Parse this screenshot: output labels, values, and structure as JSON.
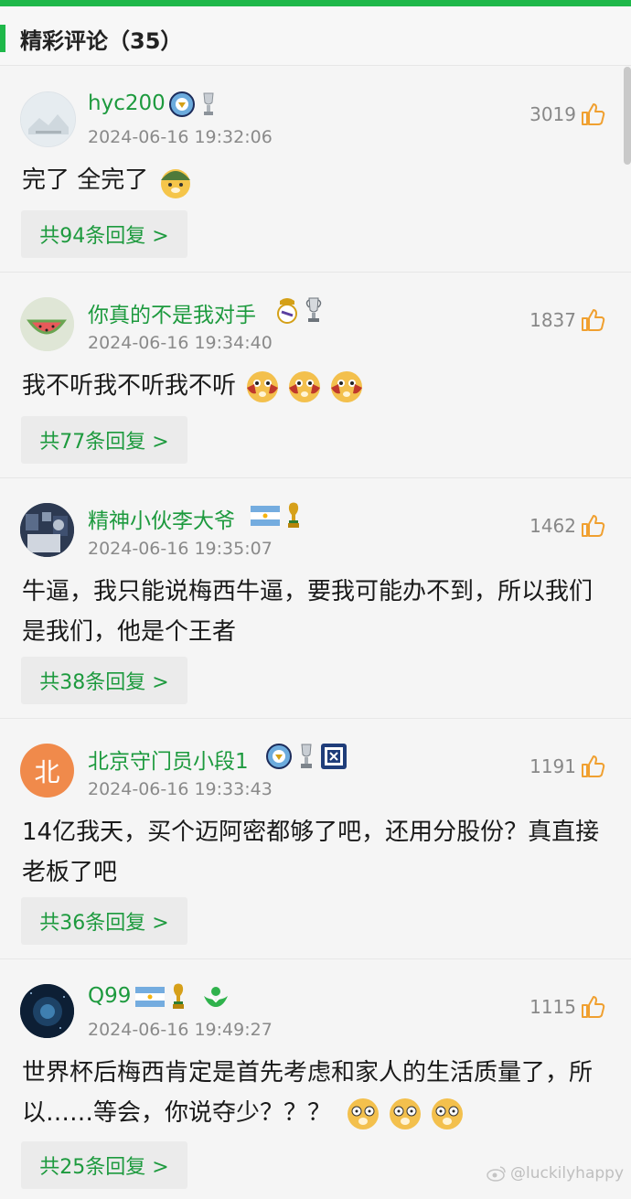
{
  "header": {
    "title": "精彩评论（35）"
  },
  "colors": {
    "brand": "#1fb84a",
    "username": "#1d9a3e",
    "thumb": "#f0a030"
  },
  "comments": [
    {
      "username": "hyc200",
      "time": "2024-06-16 19:32:06",
      "likes": "3019",
      "text": "完了 全完了",
      "emoji": [
        "helmet-doge-emoji"
      ],
      "replies": "共94条回复 >"
    },
    {
      "username": "你真的不是我对手",
      "time": "2024-06-16 19:34:40",
      "likes": "1837",
      "text": "我不听我不听我不听",
      "emoji": [
        "covering-ears-doge-emoji",
        "covering-ears-doge-emoji",
        "covering-ears-doge-emoji"
      ],
      "replies": "共77条回复 >"
    },
    {
      "username": "精神小伙李大爷",
      "time": "2024-06-16 19:35:07",
      "likes": "1462",
      "text": "牛逼，我只能说梅西牛逼，要我可能办不到，所以我们是我们，他是个王者",
      "replies": "共38条回复 >"
    },
    {
      "username": "北京守门员小段1",
      "avatar_text": "北",
      "time": "2024-06-16 19:33:43",
      "likes": "1191",
      "text": "14亿我天，买个迈阿密都够了吧，还用分股份？真直接老板了吧",
      "replies": "共36条回复 >"
    },
    {
      "username": "Q99",
      "time": "2024-06-16 19:49:27",
      "likes": "1115",
      "text": "世界杯后梅西肯定是首先考虑和家人的生活质量了，所以……等会，你说夺少？？？",
      "emoji": [
        "shocked-doge-emoji",
        "shocked-doge-emoji",
        "shocked-doge-emoji"
      ],
      "replies": "共25条回复 >"
    }
  ],
  "watermark": "@luckilyhappy"
}
